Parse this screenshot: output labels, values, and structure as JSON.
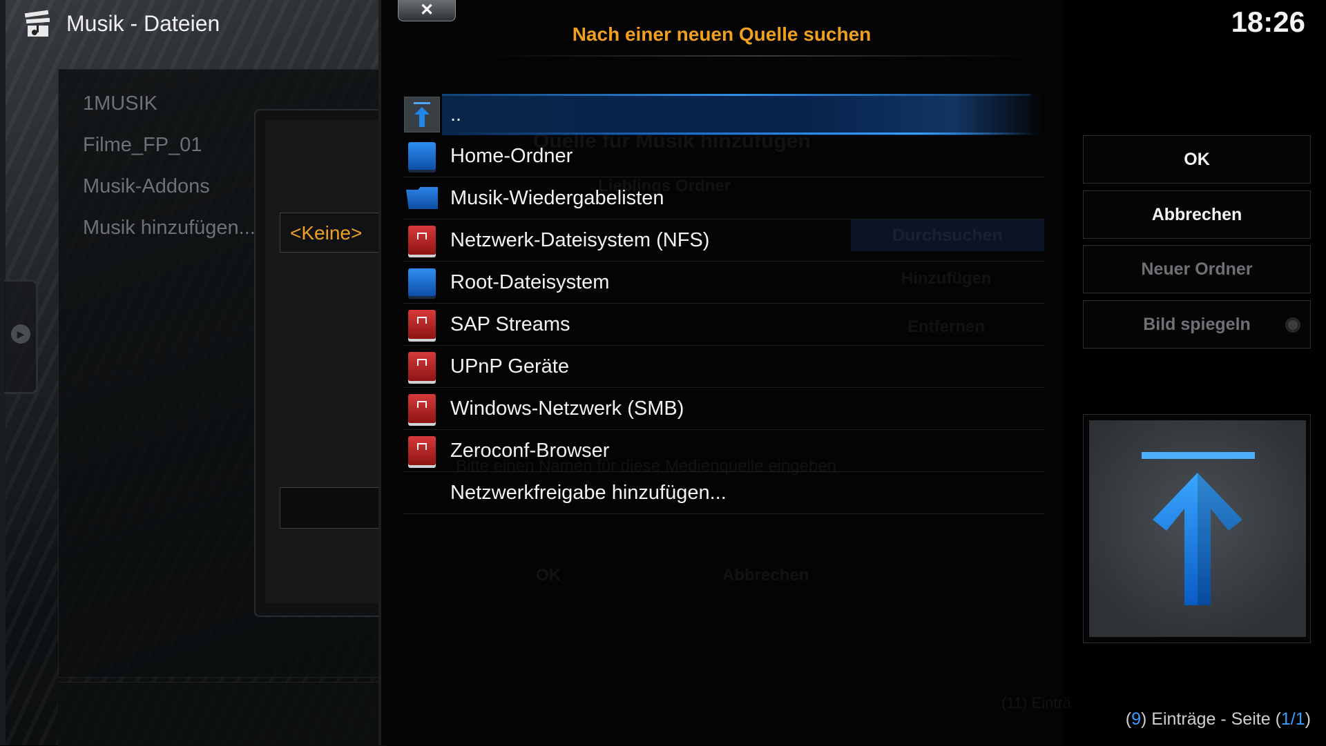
{
  "header": {
    "app_title": "Musik - Dateien",
    "clock": "18:26"
  },
  "left_list": {
    "items": [
      "1MUSIK",
      "Filme_FP_01",
      "Musik-Addons",
      "Musik hinzufügen..."
    ]
  },
  "underlying_dialog": {
    "selected_value": "<Keine>"
  },
  "dialog": {
    "close_label": "✕",
    "title": "Nach einer neuen Quelle suchen",
    "items": [
      {
        "label": "..",
        "icon": "folder-up-icon",
        "selected": true
      },
      {
        "label": "Home-Ordner",
        "icon": "drive-icon"
      },
      {
        "label": "Musik-Wiedergabelisten",
        "icon": "folder-icon"
      },
      {
        "label": "Netzwerk-Dateisystem (NFS)",
        "icon": "network-drive-icon"
      },
      {
        "label": "Root-Dateisystem",
        "icon": "drive-icon"
      },
      {
        "label": "SAP Streams",
        "icon": "network-drive-icon"
      },
      {
        "label": "UPnP Geräte",
        "icon": "network-drive-icon"
      },
      {
        "label": "Windows-Netzwerk (SMB)",
        "icon": "network-drive-icon"
      },
      {
        "label": "Zeroconf-Browser",
        "icon": "network-drive-icon"
      },
      {
        "label": "Netzwerkfreigabe hinzufügen...",
        "icon": ""
      }
    ]
  },
  "ghost": {
    "title": "Quelle für Musik hinzufügen",
    "folder_label": "Lieblings Ordner",
    "browse": "Durchsuchen",
    "add": "Hinzufügen",
    "remove": "Entfernen",
    "name_hint": "Bitte einen Namen für diese Medienquelle eingeben",
    "ok": "OK",
    "cancel": "Abbrechen",
    "items_hint": "(11) Einträ"
  },
  "right_panel": {
    "ok": "OK",
    "cancel": "Abbrechen",
    "new_folder": "Neuer Ordner",
    "mirror_image": "Bild spiegeln"
  },
  "footer": {
    "count": "9",
    "text": "Einträge - Seite",
    "page": "1/1"
  },
  "colors": {
    "accent_orange": "#f0a020",
    "accent_blue": "#3a9cff"
  }
}
